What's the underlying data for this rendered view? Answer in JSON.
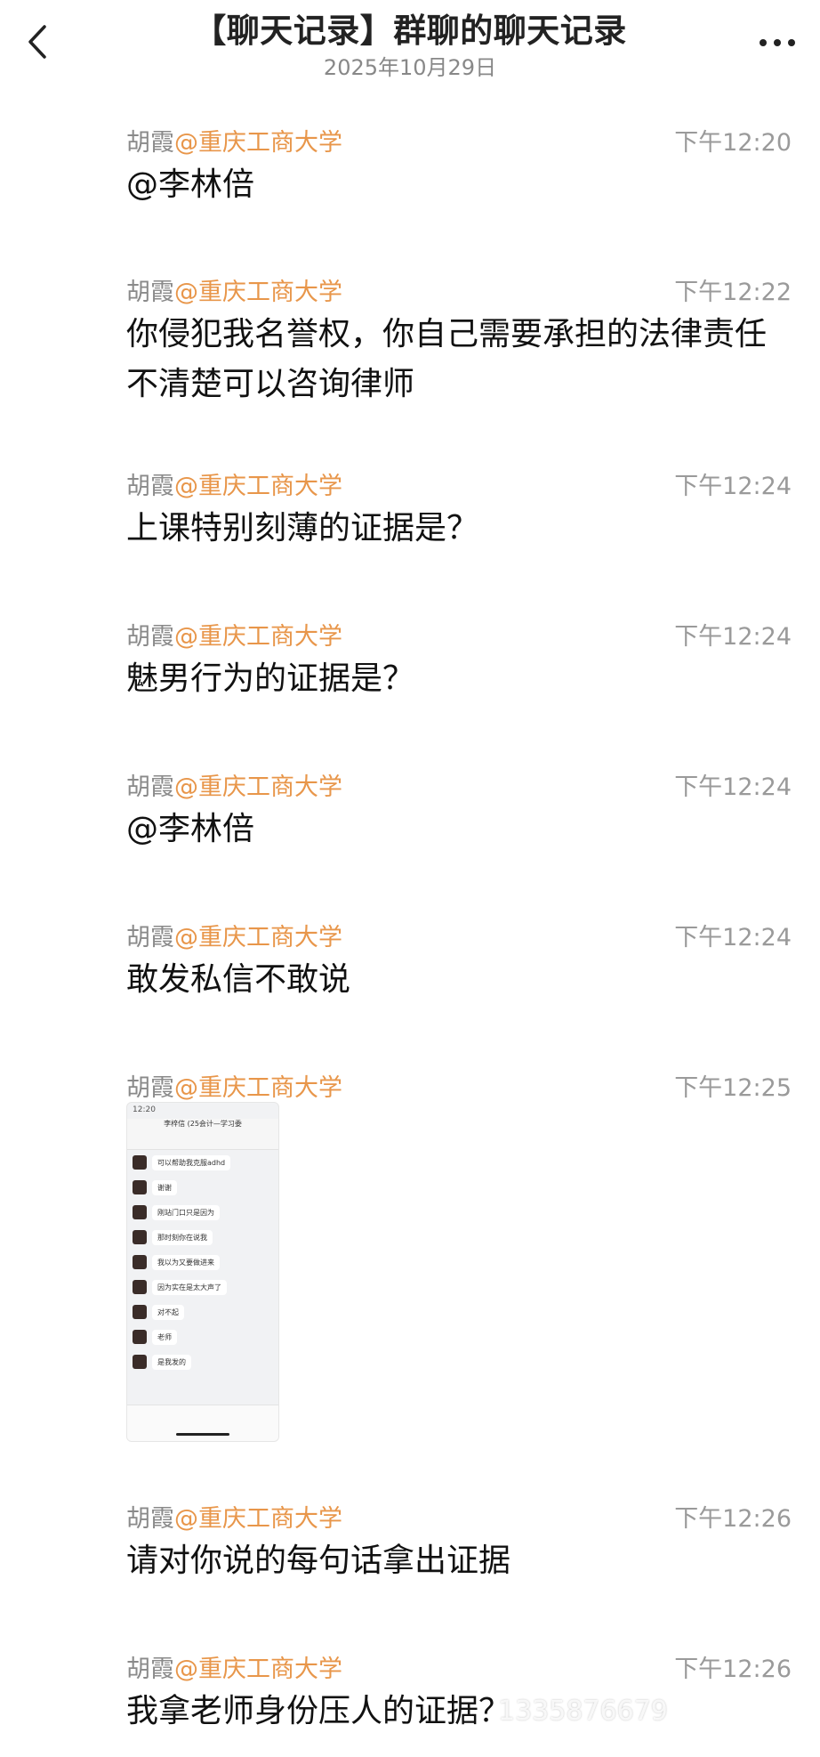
{
  "header": {
    "title": "【聊天记录】群聊的聊天记录",
    "date": "2025年10月29日",
    "back_icon": "chevron-left-icon",
    "more_icon": "more-dots-icon"
  },
  "messages": [
    {
      "sender": "胡霞",
      "tag": "@重庆工商大学",
      "time": "下午12:20",
      "text": "@李林倍"
    },
    {
      "sender": "胡霞",
      "tag": "@重庆工商大学",
      "time": "下午12:22",
      "text": "你侵犯我名誉权，你自己需要承担的法律责任不清楚可以咨询律师"
    },
    {
      "sender": "胡霞",
      "tag": "@重庆工商大学",
      "time": "下午12:24",
      "text": "上课特别刻薄的证据是？"
    },
    {
      "sender": "胡霞",
      "tag": "@重庆工商大学",
      "time": "下午12:24",
      "text": "魅男行为的证据是？"
    },
    {
      "sender": "胡霞",
      "tag": "@重庆工商大学",
      "time": "下午12:24",
      "text": "@李林倍"
    },
    {
      "sender": "胡霞",
      "tag": "@重庆工商大学",
      "time": "下午12:24",
      "text": "敢发私信不敢说"
    },
    {
      "sender": "胡霞",
      "tag": "@重庆工商大学",
      "time": "下午12:25",
      "text": ""
    },
    {
      "sender": "胡霞",
      "tag": "@重庆工商大学",
      "time": "下午12:26",
      "text": "请对你说的每句话拿出证据"
    },
    {
      "sender": "胡霞",
      "tag": "@重庆工商大学",
      "time": "下午12:26",
      "text": "我拿老师身份压人的证据？"
    }
  ],
  "screenshot": {
    "status_time": "12:20",
    "chat_title": "李梓信 (25会计—学习委",
    "bubbles": [
      "可以帮助我克服adhd",
      "谢谢",
      "刚站门口只是因为",
      "那时刻你在说我",
      "我以为又要做进来",
      "因为实在是太大声了",
      "对不起",
      "老师",
      "是我发的"
    ]
  },
  "watermark": "1335876679",
  "colors": {
    "tag": "#e8964a",
    "meta": "#8a8a8a"
  }
}
